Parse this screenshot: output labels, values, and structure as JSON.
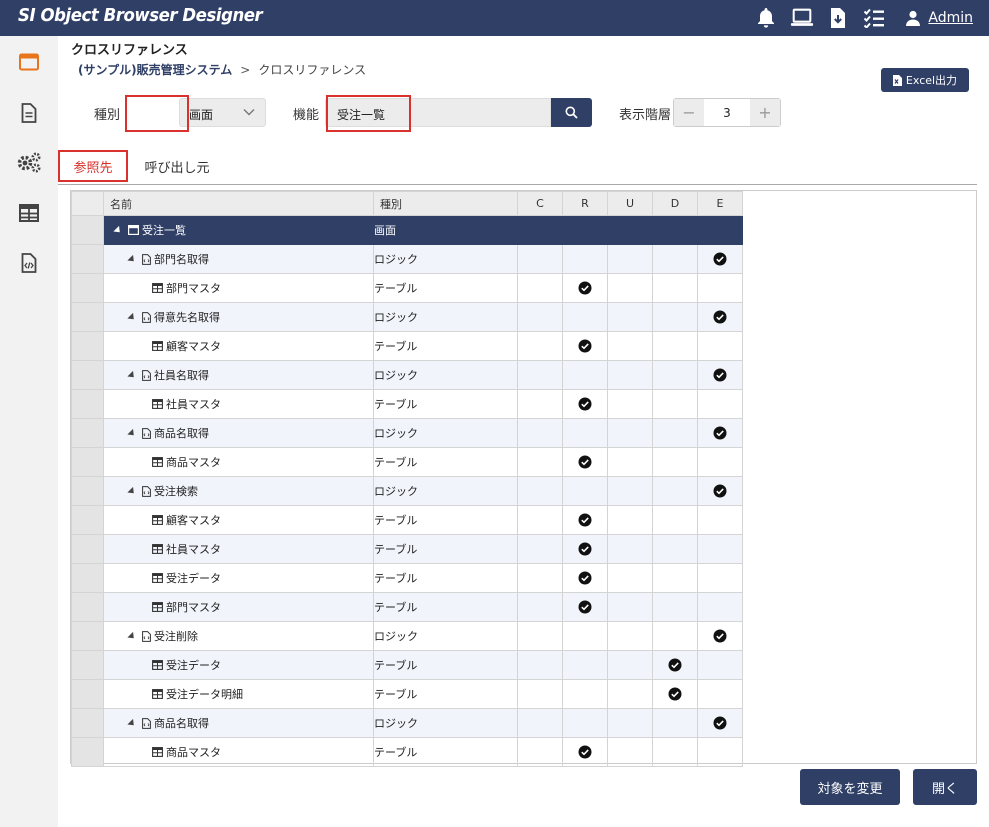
{
  "app": {
    "title": "SI Object Browser Designer"
  },
  "header": {
    "user_name": "Admin"
  },
  "page": {
    "title": "クロスリファレンス",
    "breadcrumb": {
      "parent": "(サンプル)販売管理システム",
      "sep": ">",
      "current": "クロスリファレンス"
    },
    "excel_button": "Excel出力"
  },
  "filters": {
    "kind_label": "種別",
    "kind_value": "画面",
    "func_label": "機能",
    "func_value": "受注一覧",
    "level_label": "表示階層",
    "level_value": "3",
    "minus": "−",
    "plus": "+"
  },
  "tabs": {
    "active": "参照先",
    "other": "呼び出し元"
  },
  "grid": {
    "headers": {
      "name": "名前",
      "type": "種別",
      "c": "C",
      "r": "R",
      "u": "U",
      "d": "D",
      "e": "E"
    },
    "rows": [
      {
        "level": 0,
        "icon": "screen",
        "name": "受注一覧",
        "type": "画面",
        "c": false,
        "r": false,
        "u": false,
        "d": false,
        "e": false
      },
      {
        "level": 1,
        "icon": "logic",
        "name": "部門名取得",
        "type": "ロジック",
        "c": false,
        "r": false,
        "u": false,
        "d": false,
        "e": true
      },
      {
        "level": 2,
        "icon": "table",
        "name": "部門マスタ",
        "type": "テーブル",
        "c": false,
        "r": true,
        "u": false,
        "d": false,
        "e": false
      },
      {
        "level": 1,
        "icon": "logic",
        "name": "得意先名取得",
        "type": "ロジック",
        "c": false,
        "r": false,
        "u": false,
        "d": false,
        "e": true
      },
      {
        "level": 2,
        "icon": "table",
        "name": "顧客マスタ",
        "type": "テーブル",
        "c": false,
        "r": true,
        "u": false,
        "d": false,
        "e": false
      },
      {
        "level": 1,
        "icon": "logic",
        "name": "社員名取得",
        "type": "ロジック",
        "c": false,
        "r": false,
        "u": false,
        "d": false,
        "e": true
      },
      {
        "level": 2,
        "icon": "table",
        "name": "社員マスタ",
        "type": "テーブル",
        "c": false,
        "r": true,
        "u": false,
        "d": false,
        "e": false
      },
      {
        "level": 1,
        "icon": "logic",
        "name": "商品名取得",
        "type": "ロジック",
        "c": false,
        "r": false,
        "u": false,
        "d": false,
        "e": true
      },
      {
        "level": 2,
        "icon": "table",
        "name": "商品マスタ",
        "type": "テーブル",
        "c": false,
        "r": true,
        "u": false,
        "d": false,
        "e": false
      },
      {
        "level": 1,
        "icon": "logic",
        "name": "受注検索",
        "type": "ロジック",
        "c": false,
        "r": false,
        "u": false,
        "d": false,
        "e": true
      },
      {
        "level": 2,
        "icon": "table",
        "name": "顧客マスタ",
        "type": "テーブル",
        "c": false,
        "r": true,
        "u": false,
        "d": false,
        "e": false
      },
      {
        "level": 2,
        "icon": "table",
        "name": "社員マスタ",
        "type": "テーブル",
        "c": false,
        "r": true,
        "u": false,
        "d": false,
        "e": false
      },
      {
        "level": 2,
        "icon": "table",
        "name": "受注データ",
        "type": "テーブル",
        "c": false,
        "r": true,
        "u": false,
        "d": false,
        "e": false
      },
      {
        "level": 2,
        "icon": "table",
        "name": "部門マスタ",
        "type": "テーブル",
        "c": false,
        "r": true,
        "u": false,
        "d": false,
        "e": false
      },
      {
        "level": 1,
        "icon": "logic",
        "name": "受注削除",
        "type": "ロジック",
        "c": false,
        "r": false,
        "u": false,
        "d": false,
        "e": true
      },
      {
        "level": 2,
        "icon": "table",
        "name": "受注データ",
        "type": "テーブル",
        "c": false,
        "r": false,
        "u": false,
        "d": true,
        "e": false
      },
      {
        "level": 2,
        "icon": "table",
        "name": "受注データ明細",
        "type": "テーブル",
        "c": false,
        "r": false,
        "u": false,
        "d": true,
        "e": false
      },
      {
        "level": 1,
        "icon": "logic",
        "name": "商品名取得",
        "type": "ロジック",
        "c": false,
        "r": false,
        "u": false,
        "d": false,
        "e": true
      },
      {
        "level": 2,
        "icon": "table",
        "name": "商品マスタ",
        "type": "テーブル",
        "c": false,
        "r": true,
        "u": false,
        "d": false,
        "e": false
      }
    ]
  },
  "actions": {
    "change": "対象を変更",
    "open": "開く"
  },
  "colors": {
    "navy": "#2f3f66",
    "accent_red": "#d9312b",
    "sidebar_active": "#e8741c"
  }
}
